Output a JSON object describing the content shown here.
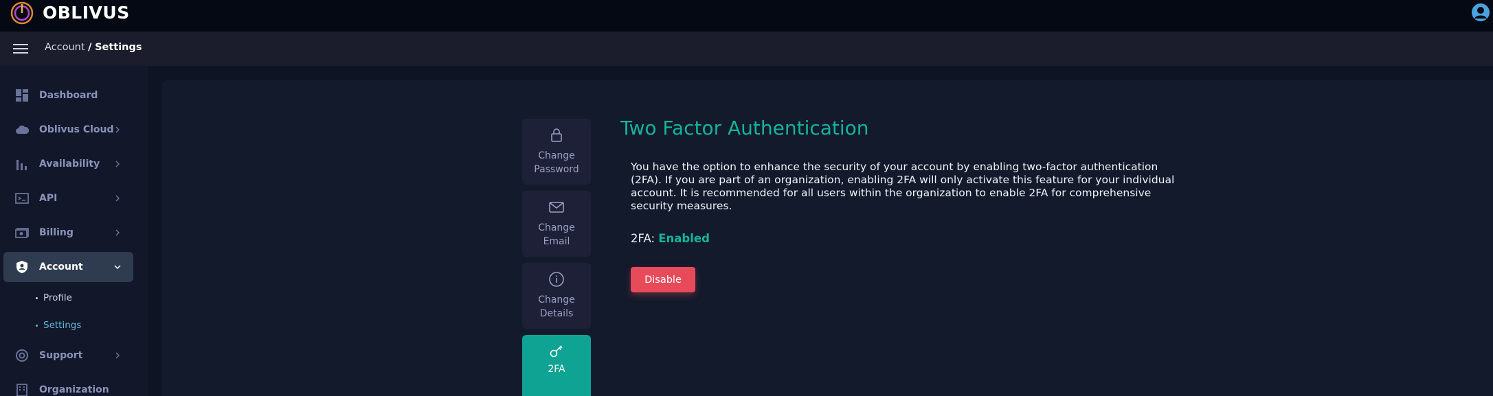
{
  "header": {
    "brand": "OBLIVUS",
    "logo_icon": "oblivus-logo-icon",
    "user_icon": "user-avatar-icon"
  },
  "breadcrumb": {
    "parent": "Account",
    "separator": "/",
    "current": "Settings"
  },
  "sidebar": {
    "items": [
      {
        "label": "Dashboard",
        "icon": "dashboard-icon",
        "has_chevron": false
      },
      {
        "label": "Oblivus Cloud",
        "icon": "cloud-icon",
        "has_chevron": true
      },
      {
        "label": "Availability",
        "icon": "bar-chart-icon",
        "has_chevron": true
      },
      {
        "label": "API",
        "icon": "terminal-icon",
        "has_chevron": true
      },
      {
        "label": "Billing",
        "icon": "billing-icon",
        "has_chevron": true
      },
      {
        "label": "Account",
        "icon": "account-shield-icon",
        "has_chevron": true,
        "active": true
      },
      {
        "label": "Support",
        "icon": "support-icon",
        "has_chevron": true
      },
      {
        "label": "Organization",
        "icon": "organization-icon",
        "has_chevron": false
      }
    ],
    "account_sub": [
      {
        "label": "Profile",
        "active": false
      },
      {
        "label": "Settings",
        "active": true
      }
    ]
  },
  "settings_tabs": [
    {
      "label": "Change Password",
      "icon": "lock-icon",
      "active": false
    },
    {
      "label": "Change Email",
      "icon": "mail-icon",
      "active": false
    },
    {
      "label": "Change Details",
      "icon": "info-icon",
      "active": false
    },
    {
      "label": "2FA",
      "icon": "key-icon",
      "active": true
    }
  ],
  "two_factor": {
    "title": "Two Factor Authentication",
    "description": "You have the option to enhance the security of your account by enabling two-factor authentication (2FA). If you are part of an organization, enabling 2FA will only activate this feature for your individual account. It is recommended for all users within the organization to enable 2FA for comprehensive security measures.",
    "status_label": "2FA:",
    "status_value": "Enabled",
    "disable_label": "Disable"
  },
  "colors": {
    "accent_teal": "#0fa394",
    "danger": "#e74a59",
    "sidebar_text": "#8a93b8",
    "active_sub": "#5fb8d9"
  }
}
